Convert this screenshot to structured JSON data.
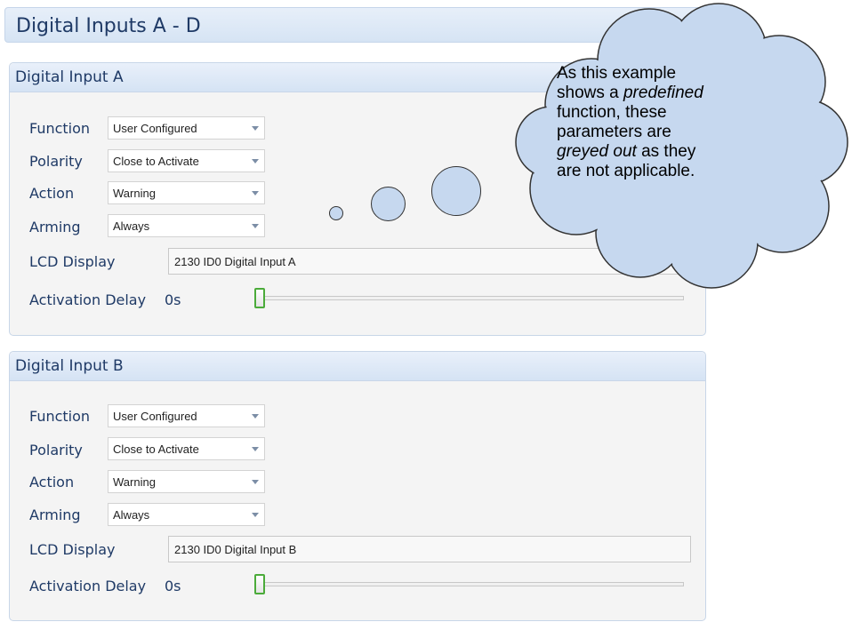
{
  "page": {
    "title": "Digital Inputs A - D"
  },
  "inputs": [
    {
      "title": "Digital Input A",
      "function_label": "Function",
      "function_value": "User Configured",
      "polarity_label": "Polarity",
      "polarity_value": "Close to Activate",
      "action_label": "Action",
      "action_value": "Warning",
      "arming_label": "Arming",
      "arming_value": "Always",
      "lcd_label": "LCD Display",
      "lcd_value": "2130 ID0 Digital Input A",
      "delay_label": "Activation Delay",
      "delay_value": "0s"
    },
    {
      "title": "Digital Input B",
      "function_label": "Function",
      "function_value": "User Configured",
      "polarity_label": "Polarity",
      "polarity_value": "Close to Activate",
      "action_label": "Action",
      "action_value": "Warning",
      "arming_label": "Arming",
      "arming_value": "Always",
      "lcd_label": "LCD Display",
      "lcd_value": "2130 ID0 Digital Input B",
      "delay_label": "Activation Delay",
      "delay_value": "0s"
    }
  ],
  "callout": {
    "line1": "As this example",
    "line2_a": "shows a ",
    "line2_b": "predefined",
    "line3": "function, these",
    "line4": "parameters are",
    "line5_a": "greyed out",
    "line5_b": " as they",
    "line6": "are not applicable."
  },
  "colors": {
    "accent": "#1f3a66",
    "cloud_fill": "#c6d8ef",
    "slider_thumb_border": "#4bab3a"
  }
}
